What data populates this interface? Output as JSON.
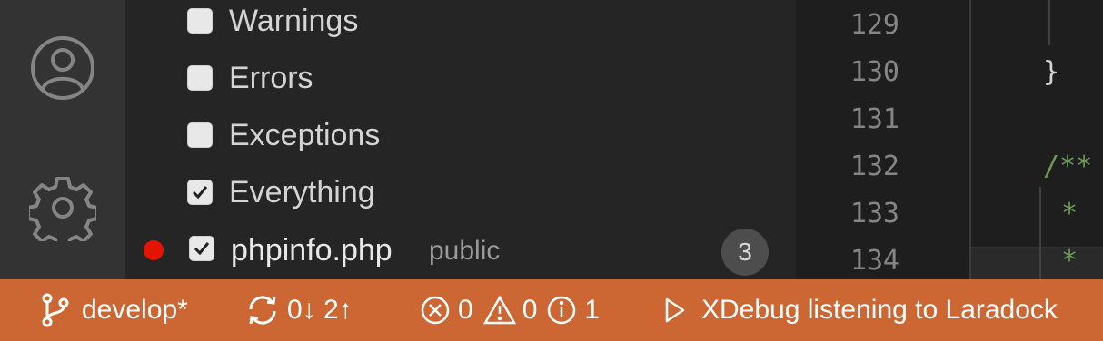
{
  "breakpoints": {
    "items": [
      {
        "label": "Warnings",
        "checked": false
      },
      {
        "label": "Errors",
        "checked": false
      },
      {
        "label": "Exceptions",
        "checked": false
      },
      {
        "label": "Everything",
        "checked": true
      }
    ],
    "file_breakpoint": {
      "checked": true,
      "file": "phpinfo.php",
      "folder": "public",
      "line": "3"
    }
  },
  "editor": {
    "line_numbers": [
      "129",
      "130",
      "131",
      "132",
      "133",
      "134"
    ],
    "code": {
      "brace": "}",
      "doc_start": "/**",
      "doc_star_1": "* ",
      "doc_star_2": "* "
    },
    "colors": {
      "comment": "#6a9955",
      "text": "#d4d4d4"
    }
  },
  "status_bar": {
    "color": "#cc6633",
    "branch": "develop*",
    "sync": "0↓ 2↑",
    "errors": "0",
    "warnings": "0",
    "infos": "1",
    "debug_status": "XDebug listening to Laradock"
  }
}
